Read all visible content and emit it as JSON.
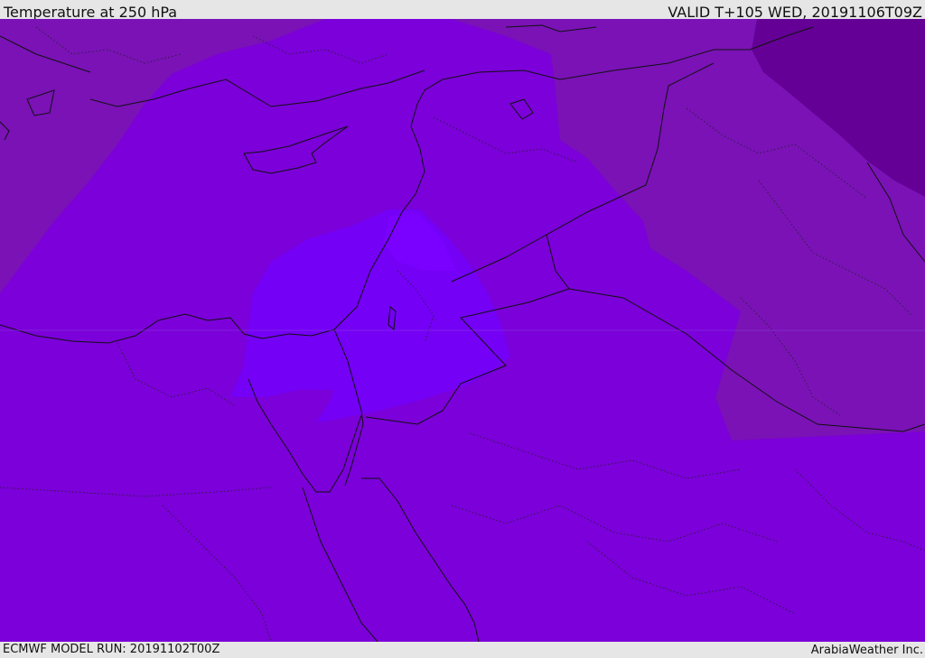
{
  "header": {
    "title": "Temperature at 250 hPa",
    "valid": "VALID T+105 WED, 20191106T09Z"
  },
  "footer": {
    "model_run": "ECMWF MODEL RUN: 20191102T00Z",
    "credit": "ArabiaWeather Inc."
  },
  "map": {
    "field": "temperature",
    "level": "250 hPa",
    "colors": {
      "base": "#7b00d9",
      "cold_outer": "#7a12b6",
      "coldest": "#640095",
      "warm": "#7400f5",
      "warmest": "#7a00ff"
    }
  }
}
